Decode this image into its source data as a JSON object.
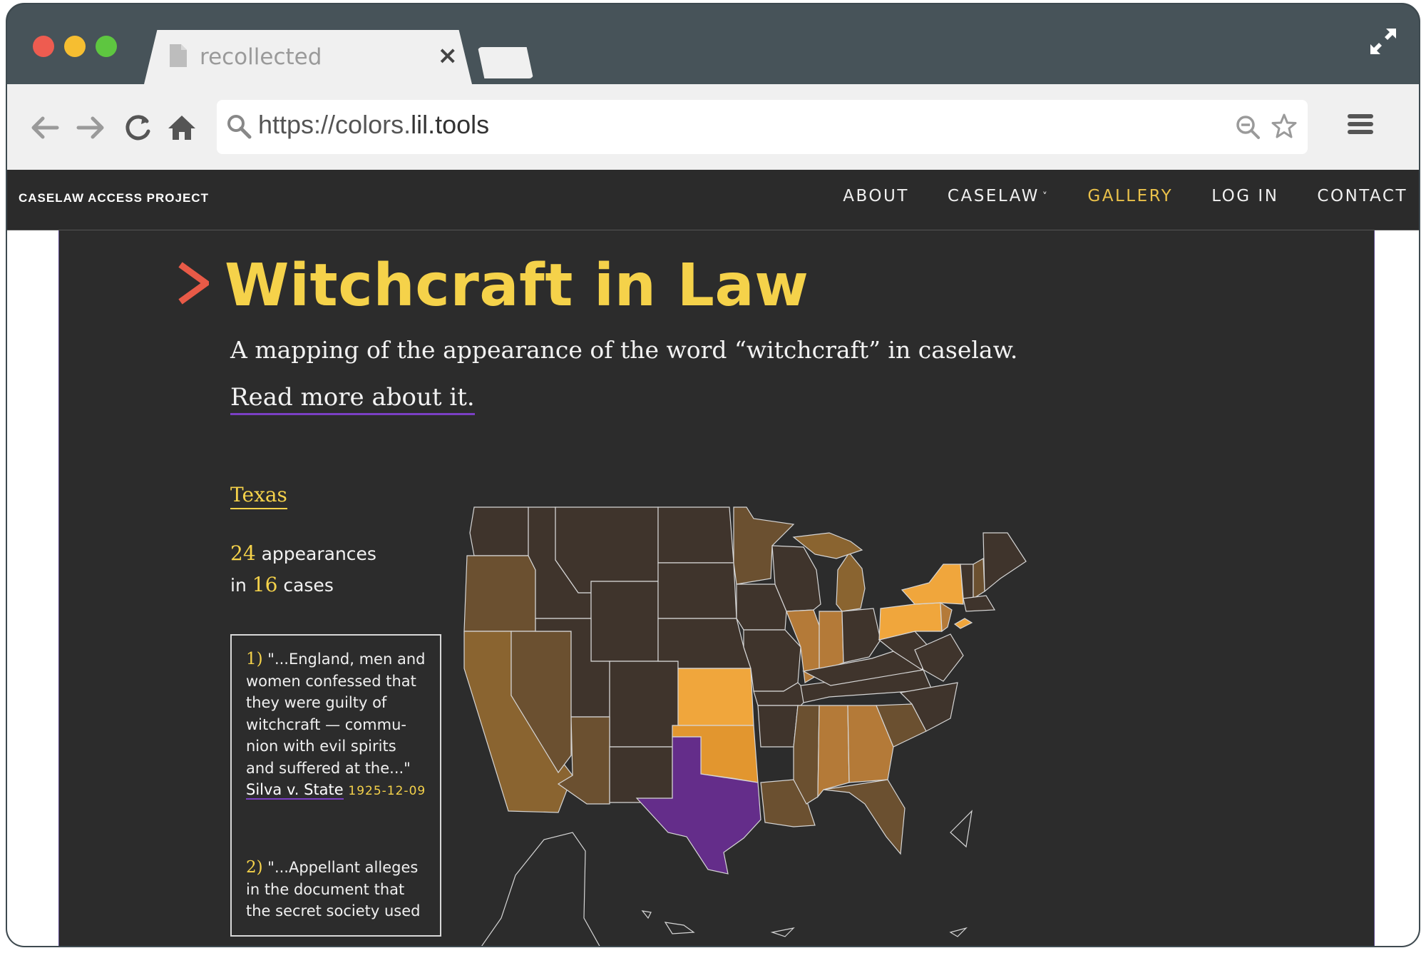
{
  "browser": {
    "tab_title": "recollected",
    "tab_close": "×",
    "url_prefix": "https://colors.",
    "url_domain": "lil.tools"
  },
  "site": {
    "brand": "CASELAW ACCESS PROJECT",
    "nav": {
      "about": "ABOUT",
      "caselaw": "CASELAW",
      "caselaw_caret": "˅",
      "gallery": "GALLERY",
      "login": "LOG IN",
      "contact": "CONTACT"
    },
    "active_nav": "GALLERY"
  },
  "page": {
    "title": "Witchcraft in Law",
    "subtitle": "A mapping of the appearance of the word “witchcraft” in caselaw.",
    "read_more": "Read more about it.",
    "selected_state": "Texas",
    "appearances_count": "24",
    "appearances_label": "appearances",
    "in_label": "in",
    "cases_count": "16",
    "cases_label": "cases"
  },
  "quotes": [
    {
      "num": "1)",
      "text": "\"...England, men and women confessed that they were guilty of witchcraft — commu- nion with evil spirits and suffered at the...\"",
      "case": "Silva v. State",
      "date": "1925-12-09"
    },
    {
      "num": "2)",
      "text": "\"...Appellant alleges in the document that the secret society used"
    }
  ],
  "colors": {
    "accent_yellow": "#f5d24a",
    "purple_selected": "#642d8a",
    "underline_purple": "#7b3fc4",
    "panel_bg": "#2c2c2c",
    "state_high": "#f0a63c",
    "state_mid": "#b47a38",
    "state_low": "#6b5030",
    "state_none": "#3f342c"
  },
  "icons": {
    "document": "document-icon",
    "expand": "expand-icon",
    "back": "back-arrow-icon",
    "forward": "forward-arrow-icon",
    "reload": "reload-icon",
    "home": "home-icon",
    "search": "search-icon",
    "zoom": "zoom-out-icon",
    "star": "star-icon",
    "menu": "hamburger-menu-icon",
    "logo": "chevron-logo-icon"
  }
}
